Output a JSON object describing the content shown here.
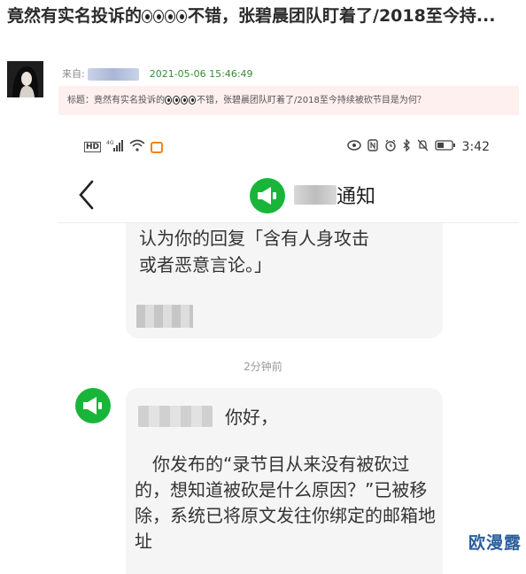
{
  "post": {
    "title_part1": "竟然有实名投诉的",
    "title_part2": "不错，张碧晨团队盯着了/2018至今持...",
    "title_eye_icon": "eyes-emoji"
  },
  "meta": {
    "from_label": "来自:",
    "date": "2021-05-06 15:46:49"
  },
  "quote": {
    "text_part1": "标题：竟然有实名投诉的",
    "text_part2": "不错，张碧晨团队盯着了/2018至今持续被砍节目是为何？"
  },
  "phone": {
    "status_bar": {
      "hd_label": "HD",
      "network": "4G",
      "time": "3:42"
    },
    "nav": {
      "title_suffix": "通知"
    },
    "message1": {
      "line1": "认为你的回复「含有人身攻击",
      "line2": "或者恶意言论。」"
    },
    "time_divider": "2分钟前",
    "message2": {
      "greeting": "你好，",
      "body": "　你发布的“录节目从来没有被砍过的，想知道被砍是什么原因？”已被移除，系统已将原文发往你绑定的邮箱地址"
    },
    "accent_green": "#19b53b"
  },
  "watermark": "欧漫露"
}
